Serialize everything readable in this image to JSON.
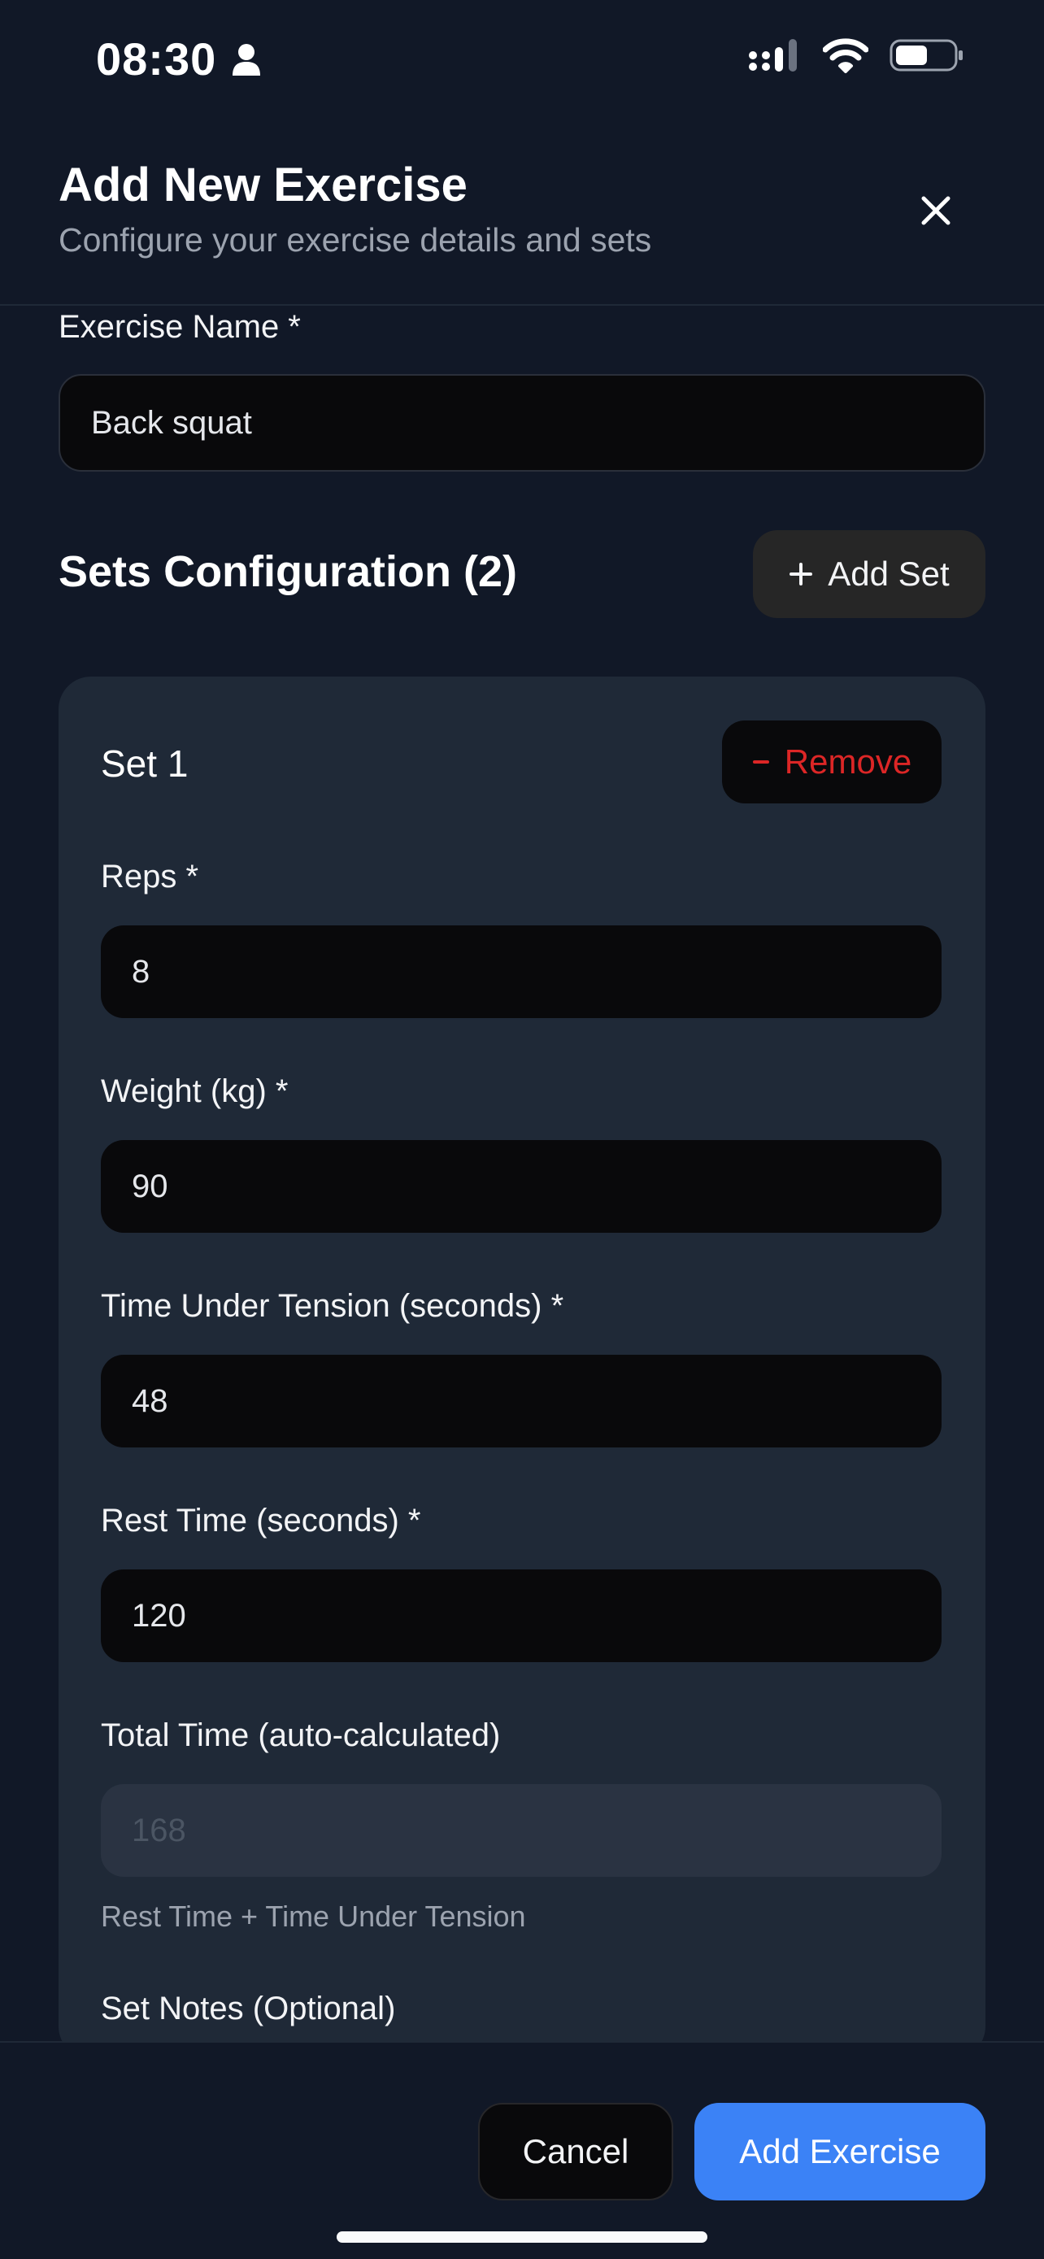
{
  "status_bar": {
    "time": "08:30"
  },
  "header": {
    "title": "Add New Exercise",
    "subtitle": "Configure your exercise details and sets"
  },
  "exercise_name": {
    "label": "Exercise Name *",
    "value": "Back squat"
  },
  "sets_section": {
    "title": "Sets Configuration (2)",
    "add_set_label": "Add Set"
  },
  "set": {
    "title": "Set 1",
    "remove_label": "Remove",
    "reps": {
      "label": "Reps *",
      "value": "8"
    },
    "weight": {
      "label": "Weight (kg) *",
      "value": "90"
    },
    "tut": {
      "label": "Time Under Tension (seconds) *",
      "value": "48"
    },
    "rest": {
      "label": "Rest Time (seconds) *",
      "value": "120"
    },
    "total": {
      "label": "Total Time (auto-calculated)",
      "value": "168",
      "hint": "Rest Time + Time Under Tension"
    },
    "notes": {
      "label": "Set Notes (Optional)"
    }
  },
  "footer": {
    "cancel_label": "Cancel",
    "add_label": "Add Exercise"
  },
  "colors": {
    "background": "#111827",
    "card": "#1f2937",
    "primary": "#3b82f6",
    "danger": "#dc2626"
  }
}
